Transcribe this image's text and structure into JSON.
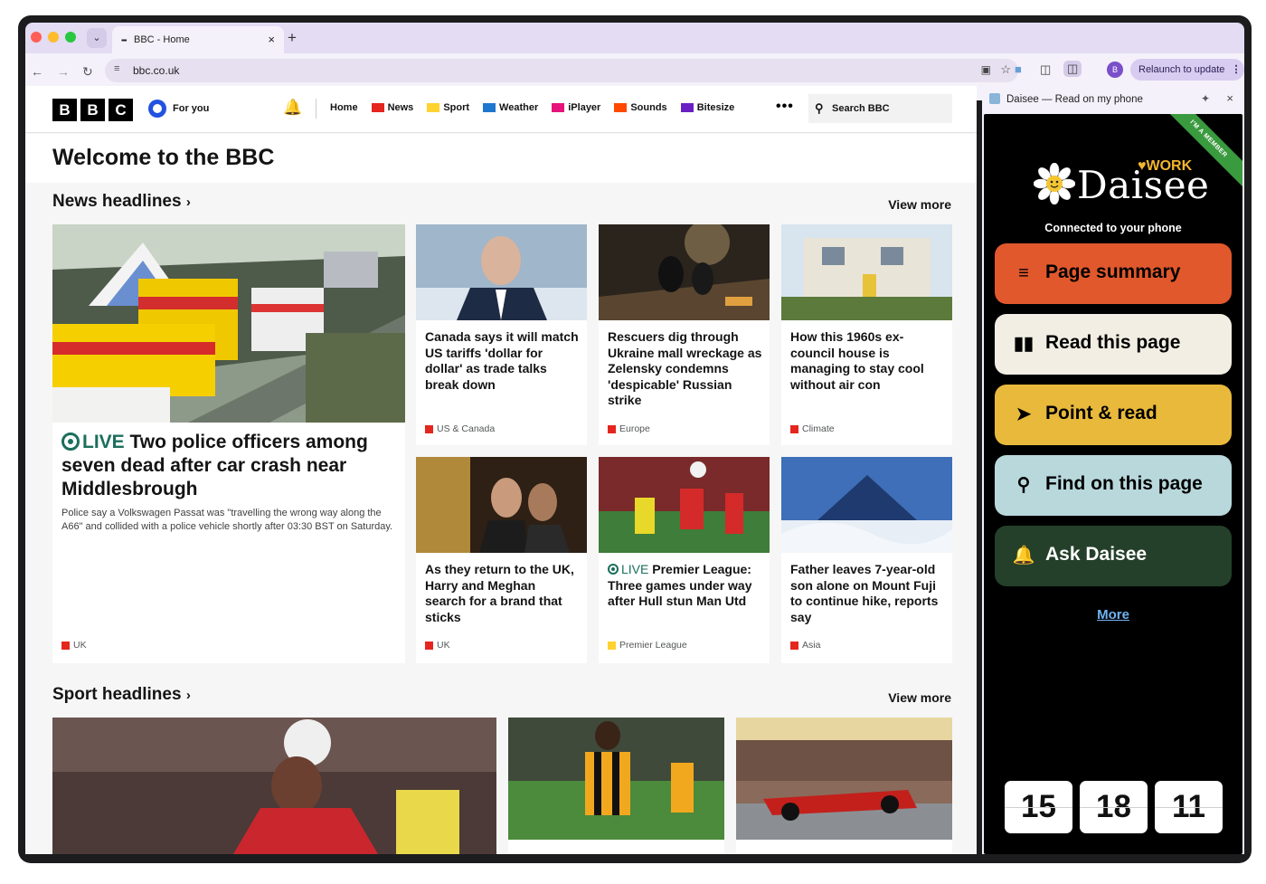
{
  "browser": {
    "tab_title": "BBC - Home",
    "tab_favicon": "▪▪▪",
    "url": "bbc.co.uk",
    "relaunch_label": "Relaunch to update",
    "profile_initial": "B"
  },
  "bbc": {
    "logo": [
      "B",
      "B",
      "C"
    ],
    "for_you": "For you",
    "nav": [
      {
        "label": "Home",
        "color": ""
      },
      {
        "label": "News",
        "color": "#e4261f"
      },
      {
        "label": "Sport",
        "color": "#ffd230"
      },
      {
        "label": "Weather",
        "color": "#1e77cf"
      },
      {
        "label": "iPlayer",
        "color": "#e5137b"
      },
      {
        "label": "Sounds",
        "color": "#ff4900"
      },
      {
        "label": "Bitesize",
        "color": "#6a1fc2"
      }
    ],
    "more": "•••",
    "search_label": "Search BBC",
    "welcome": "Welcome to the BBC",
    "news_section": {
      "title": "News headlines",
      "view_more": "View more",
      "lead": {
        "live": "LIVE",
        "headline": "Two police officers among seven dead after car crash near Middlesbrough",
        "summary": "Police say a Volkswagen Passat was \"travelling the wrong way along the A66\" and collided with a police vehicle shortly after 03:30 BST on Saturday.",
        "tag": "UK"
      },
      "cards": [
        {
          "headline": "Canada says it will match US tariffs 'dollar for dollar' as trade talks break down",
          "tag": "US & Canada"
        },
        {
          "headline": "Rescuers dig through Ukraine mall wreckage as Zelensky condemns 'despicable' Russian strike",
          "tag": "Europe"
        },
        {
          "headline": "How this 1960s ex-council house is managing to stay cool without air con",
          "tag": "Climate"
        },
        {
          "headline": "As they return to the UK, Harry and Meghan search for a brand that sticks",
          "tag": "UK"
        },
        {
          "live": "LIVE",
          "headline": "Premier League: Three games under way after Hull stun Man Utd",
          "tag": "Premier League"
        },
        {
          "headline": "Father leaves 7-year-old son alone on Mount Fuji to continue hike, reports say",
          "tag": "Asia"
        }
      ]
    },
    "sport_section": {
      "title": "Sport headlines",
      "view_more": "View more"
    }
  },
  "sidepanel": {
    "title": "Daisee — Read on my phone",
    "ribbon": "I'M A MEMBER",
    "brand_work": "♥WORK",
    "brand_name": "Daisee",
    "connected": "Connected to your phone",
    "buttons": [
      {
        "label": "Page summary",
        "icon": "lines-icon",
        "bg": "#e1582c",
        "fg": "#000000"
      },
      {
        "label": "Read this page",
        "icon": "book-icon",
        "bg": "#f2eee3",
        "fg": "#000000"
      },
      {
        "label": "Point & read",
        "icon": "pointer-icon",
        "bg": "#e8b93b",
        "fg": "#000000"
      },
      {
        "label": "Find on this page",
        "icon": "search-icon",
        "bg": "#b8d8dc",
        "fg": "#000000"
      },
      {
        "label": "Ask Daisee",
        "icon": "bell-icon",
        "bg": "#24402a",
        "fg": "#ffffff"
      }
    ],
    "more": "More",
    "clock": [
      "15",
      "18",
      "11"
    ]
  },
  "colors": {
    "news_tag": "#e4261f",
    "sport_tag": "#ffd230",
    "live_green": "#1b6f5c"
  }
}
